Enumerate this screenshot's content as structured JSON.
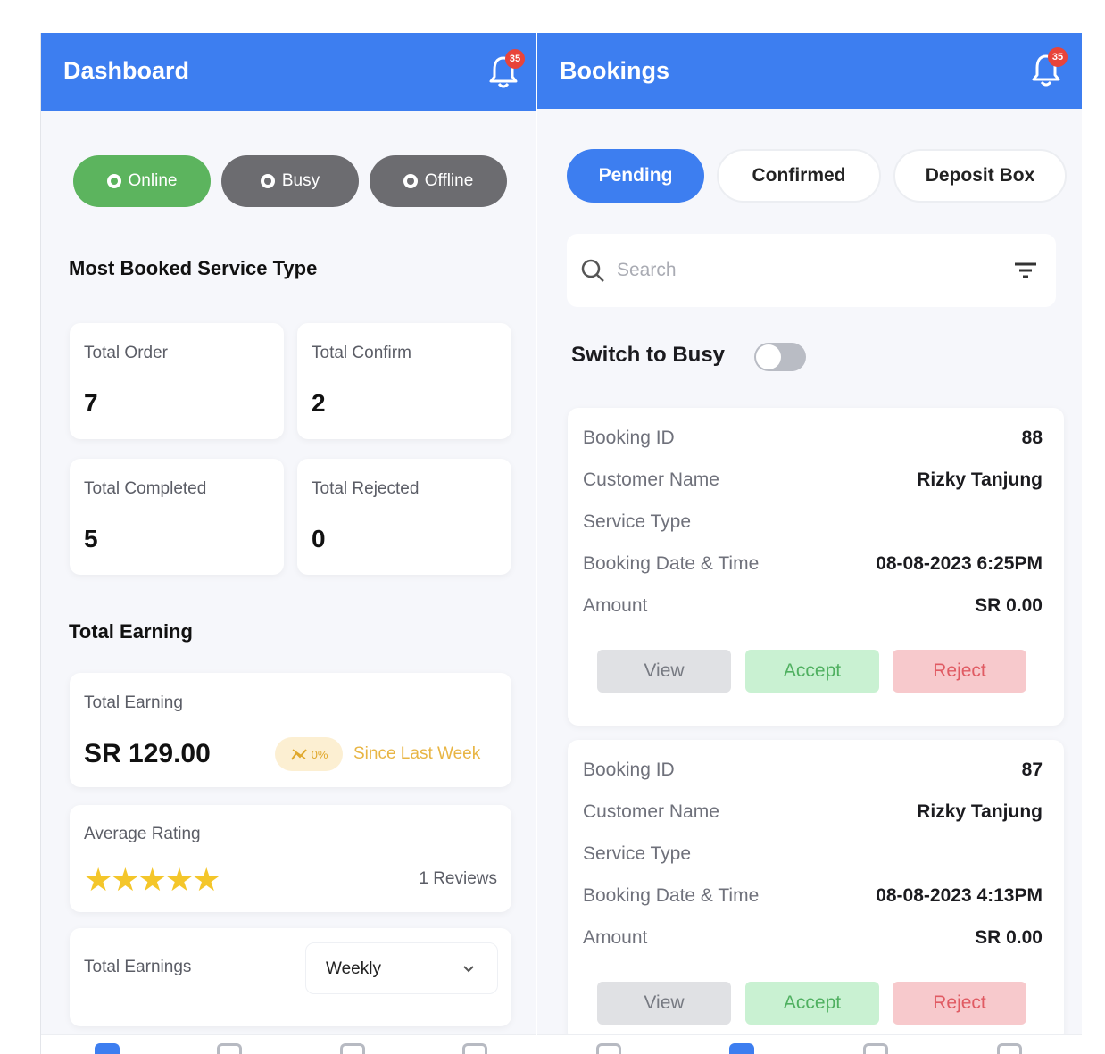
{
  "dashboard": {
    "title": "Dashboard",
    "notification_count": "35",
    "status": {
      "online": "Online",
      "busy": "Busy",
      "offline": "Offline"
    },
    "most_booked_title": "Most Booked Service Type",
    "stats": [
      {
        "label": "Total Order",
        "value": "7"
      },
      {
        "label": "Total Confirm",
        "value": "2"
      },
      {
        "label": "Total Completed",
        "value": "5"
      },
      {
        "label": "Total Rejected",
        "value": "0"
      }
    ],
    "total_earning_title": "Total Earning",
    "earning": {
      "label": "Total Earning",
      "value": "SR 129.00",
      "trend": "0%",
      "since": "Since Last Week"
    },
    "rating": {
      "label": "Average Rating",
      "stars": "★★★★★",
      "stars_value": 5,
      "reviews": "1 Reviews"
    },
    "earnings_filter": {
      "label": "Total Earnings",
      "selected": "Weekly"
    }
  },
  "bookings": {
    "title": "Bookings",
    "notification_count": "35",
    "tabs": [
      {
        "label": "Pending",
        "active": true
      },
      {
        "label": "Confirmed",
        "active": false
      },
      {
        "label": "Deposit Box",
        "active": false
      }
    ],
    "search_placeholder": "Search",
    "switch_label": "Switch to Busy",
    "switch_on": false,
    "field_labels": {
      "booking_id": "Booking ID",
      "customer_name": "Customer Name",
      "service_type": "Service Type",
      "date_time": "Booking Date & Time",
      "amount": "Amount"
    },
    "actions": {
      "view": "View",
      "accept": "Accept",
      "reject": "Reject"
    },
    "items": [
      {
        "booking_id": "88",
        "customer_name": "Rizky Tanjung",
        "service_type": "",
        "date_time": "08-08-2023 6:25PM",
        "amount": "SR 0.00"
      },
      {
        "booking_id": "87",
        "customer_name": "Rizky Tanjung",
        "service_type": "",
        "date_time": "08-08-2023 4:13PM",
        "amount": "SR 0.00"
      }
    ]
  },
  "colors": {
    "primary": "#3d7ef0",
    "online": "#5cb45e",
    "busy": "#6c6c70",
    "star": "#f4c62a",
    "badge": "#e8443a"
  }
}
